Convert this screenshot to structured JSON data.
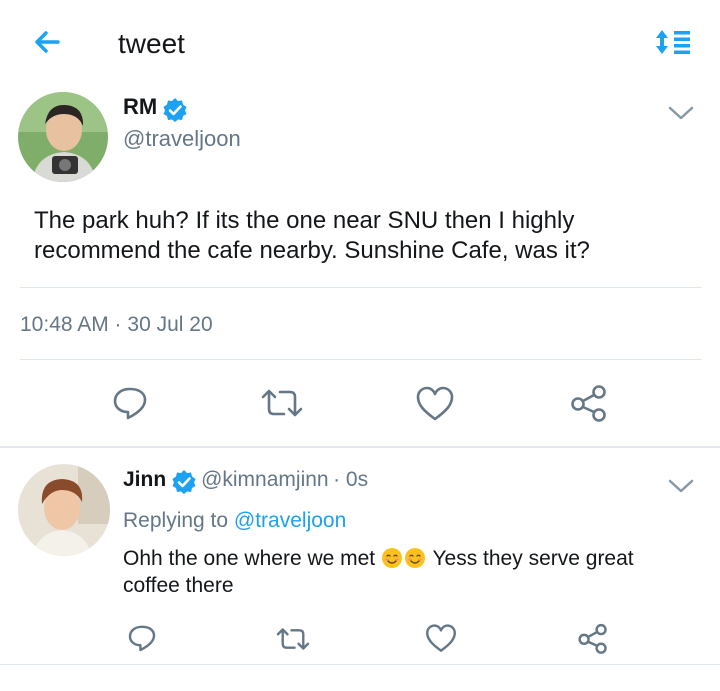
{
  "header": {
    "title": "tweet",
    "back_icon": "arrow-left-icon",
    "sort_icon": "sort-icon",
    "accent": "#1da1f2"
  },
  "main_tweet": {
    "name": "RM",
    "handle": "@traveljoon",
    "verified": true,
    "text": "The park huh? If its the one near SNU then I highly recommend the cafe nearby. Sunshine Cafe, was it?",
    "timestamp": "10:48 AM · 30 Jul 20",
    "actions": [
      "reply-icon",
      "retweet-icon",
      "like-icon",
      "share-icon"
    ]
  },
  "reply_tweet": {
    "name": "Jinn",
    "handle": "@kimnamjinn",
    "time": "· 0s",
    "replying_prefix": "Replying to",
    "replying_to": "@traveljoon",
    "text_before": "Ohh the one where we met",
    "emoji": "😊😊",
    "text_after": " Yess they serve great coffee there",
    "actions": [
      "reply-icon",
      "retweet-icon",
      "like-icon",
      "share-icon"
    ]
  },
  "colors": {
    "text": "#14171a",
    "secondary": "#657786",
    "divider": "#e1e8ed",
    "icon": "#657786"
  }
}
